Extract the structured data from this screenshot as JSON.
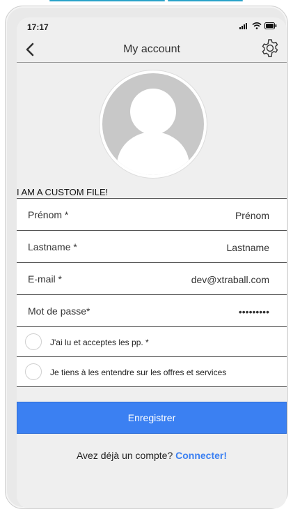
{
  "status": {
    "time": "17:17"
  },
  "header": {
    "title": "My account"
  },
  "custom_file_text": "I AM A CUSTOM FILE!",
  "form": {
    "fields": [
      {
        "label": "Prénom *",
        "value": "",
        "placeholder": "Prénom"
      },
      {
        "label": "Lastname *",
        "value": "",
        "placeholder": "Lastname"
      },
      {
        "label": "E-mail *",
        "value": "dev@xtraball.com",
        "placeholder": ""
      },
      {
        "label": "Mot de passe*",
        "value": "•••••••••",
        "placeholder": ""
      }
    ],
    "checkboxes": [
      {
        "label": "J'ai lu et acceptes les pp. *"
      },
      {
        "label": "Je tiens à les entendre sur les offres et services"
      }
    ],
    "submit_label": "Enregistrer"
  },
  "footer": {
    "prompt": "Avez déjà un compte?",
    "link": "Connecter!"
  },
  "colors": {
    "accent": "#3b80f2",
    "screen_bg": "#efefef",
    "frame_bg": "#e9e9e9"
  },
  "icons": [
    "back-icon",
    "gear-icon",
    "signal-icon",
    "wifi-icon",
    "battery-icon",
    "avatar-placeholder-icon"
  ]
}
